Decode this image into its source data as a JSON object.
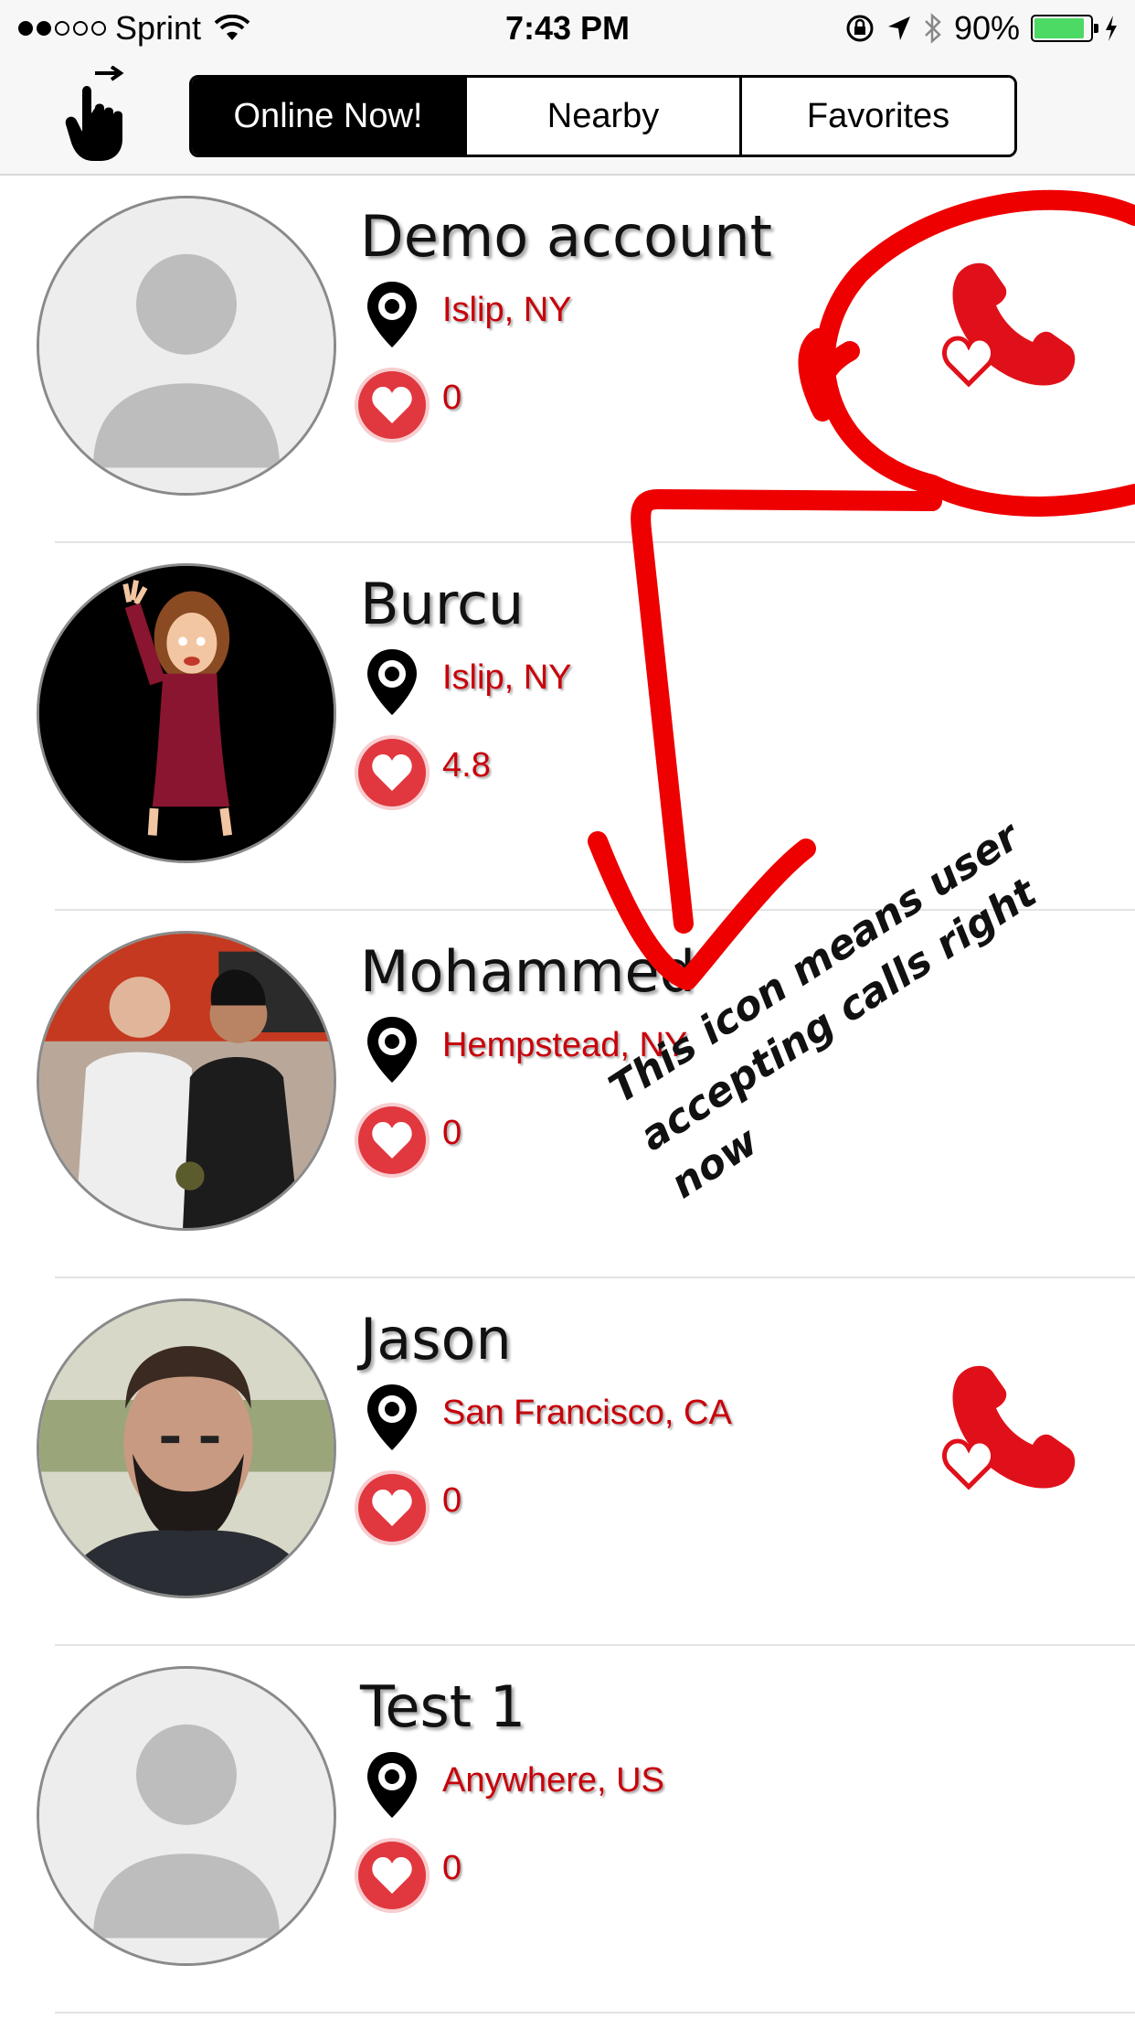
{
  "status_bar": {
    "carrier": "Sprint",
    "time": "7:43 PM",
    "battery_percent": "90%",
    "battery_level": 0.9,
    "battery_color": "#4cd964",
    "signal_bars_filled": 2,
    "signal_bars_total": 5,
    "icons": [
      "wifi-icon",
      "rotation-lock-icon",
      "location-arrow-icon",
      "bluetooth-icon",
      "charging-icon"
    ]
  },
  "nav": {
    "swipe_icon": "swipe-hand-icon",
    "tabs": [
      {
        "label": "Online Now!",
        "active": true
      },
      {
        "label": "Nearby",
        "active": false
      },
      {
        "label": "Favorites",
        "active": false
      }
    ]
  },
  "users": [
    {
      "name": "Demo account",
      "location": "Islip, NY",
      "rating": "0",
      "accepting_calls": true,
      "avatar": "placeholder"
    },
    {
      "name": "Burcu",
      "location": "Islip, NY",
      "rating": "4.8",
      "accepting_calls": false,
      "avatar": "bitmoji"
    },
    {
      "name": "Mohammed",
      "location": "Hempstead, NY",
      "rating": "0",
      "accepting_calls": false,
      "avatar": "photo"
    },
    {
      "name": "Jason",
      "location": "San Francisco, CA",
      "rating": "0",
      "accepting_calls": true,
      "avatar": "photo"
    },
    {
      "name": "Test 1",
      "location": "Anywhere, US",
      "rating": "0",
      "accepting_calls": false,
      "avatar": "placeholder"
    }
  ],
  "colors": {
    "accent_red": "#c8000a",
    "heart_red": "#e1373f",
    "annotation_red": "#ee0000"
  },
  "annotation": {
    "text": "This icon means user\naccepting calls right now"
  }
}
